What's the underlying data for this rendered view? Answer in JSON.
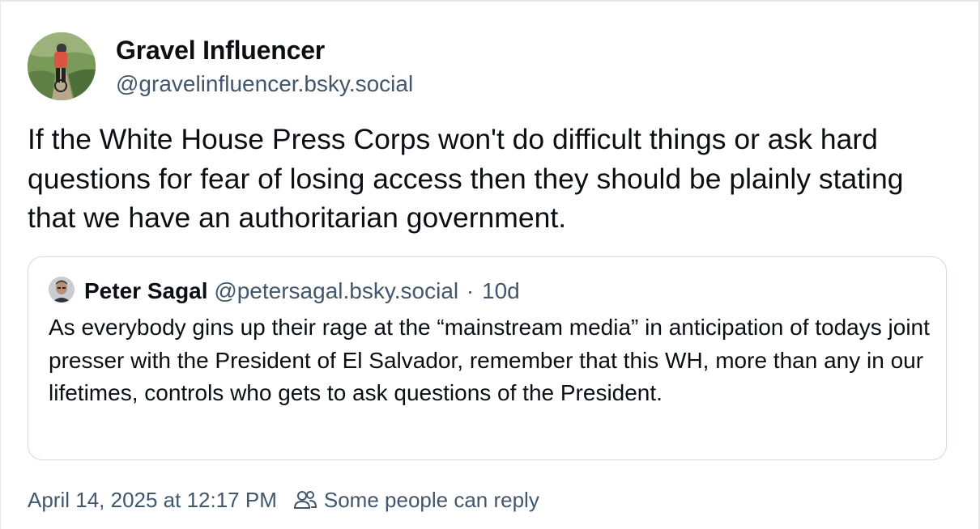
{
  "post": {
    "author": {
      "display_name": "Gravel Influencer",
      "handle": "@gravelinfluencer.bsky.social"
    },
    "text": "If the White House Press Corps won't do difficult things or ask hard questions for fear of losing access then they should be plainly stating that we have an authoritarian government.",
    "quote": {
      "display_name": "Peter Sagal",
      "handle": "@petersagal.bsky.social",
      "separator": "·",
      "time": "10d",
      "text": "As everybody gins up their rage at the “mainstream media” in anticipation of todays joint presser with the President of El Salvador, remember that this WH, more than any in our lifetimes, controls who gets to ask questions of the President."
    },
    "footer": {
      "timestamp": "April 14, 2025 at 12:17 PM",
      "reply_setting": "Some people can reply",
      "reply_icon": "people-icon"
    }
  },
  "colors": {
    "text_primary": "#0b0f14",
    "text_secondary": "#42576c",
    "border": "#d4d9e0"
  }
}
